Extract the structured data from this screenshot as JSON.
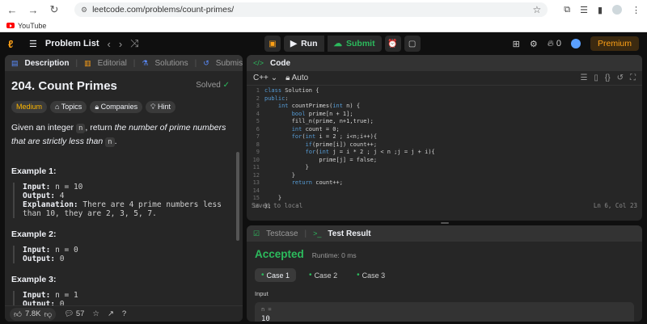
{
  "browser": {
    "url": "leetcode.com/problems/count-primes/",
    "bookmark": "YouTube"
  },
  "topbar": {
    "problem_list": "Problem List",
    "run": "Run",
    "submit": "Submit",
    "streak": "0",
    "premium": "Premium"
  },
  "left": {
    "tabs": [
      "Description",
      "Editorial",
      "Solutions",
      "Submissions"
    ],
    "title": "204. Count Primes",
    "solved": "Solved",
    "chips": [
      "Medium",
      "Topics",
      "Companies",
      "Hint"
    ],
    "desc_pre": "Given an integer",
    "desc_code": "n",
    "desc_mid": ", return",
    "desc_em": "the number of prime numbers that are strictly less than",
    "desc_code2": "n",
    "desc_end": ".",
    "examples": [
      {
        "title": "Example 1:",
        "input": "n = 10",
        "output": "4",
        "explanation": "There are 4 prime numbers less than 10, they are 2, 3, 5, 7."
      },
      {
        "title": "Example 2:",
        "input": "n = 0",
        "output": "0"
      },
      {
        "title": "Example 3:",
        "input": "n = 1",
        "output": "0"
      }
    ],
    "labels": {
      "input": "Input:",
      "output": "Output:",
      "explanation": "Explanation:"
    },
    "likes": "7.8K",
    "comments": "57"
  },
  "code": {
    "tab": "Code",
    "language": "C++",
    "mode": "Auto",
    "lines": [
      "class Solution {",
      "public:",
      "    int countPrimes(int n) {",
      "        bool prime[n + 1];",
      "        fill_n(prime, n+1,true);",
      "        int count = 0;",
      "        for(int i = 2 ; i<n;i++){",
      "            if(prime[i]) count++;",
      "            for(int j = i * 2 ; j < n ;j = j + i){",
      "                prime[j] = false;",
      "            }",
      "        }",
      "        return count++;",
      "",
      "    }",
      "};"
    ],
    "status_left": "Saved to local",
    "status_right": "Ln 6, Col 23"
  },
  "result": {
    "tabs": [
      "Testcase",
      "Test Result"
    ],
    "status": "Accepted",
    "runtime": "Runtime: 0 ms",
    "cases": [
      "Case 1",
      "Case 2",
      "Case 3"
    ],
    "input_label": "Input",
    "var_name": "n =",
    "var_value": "10"
  }
}
